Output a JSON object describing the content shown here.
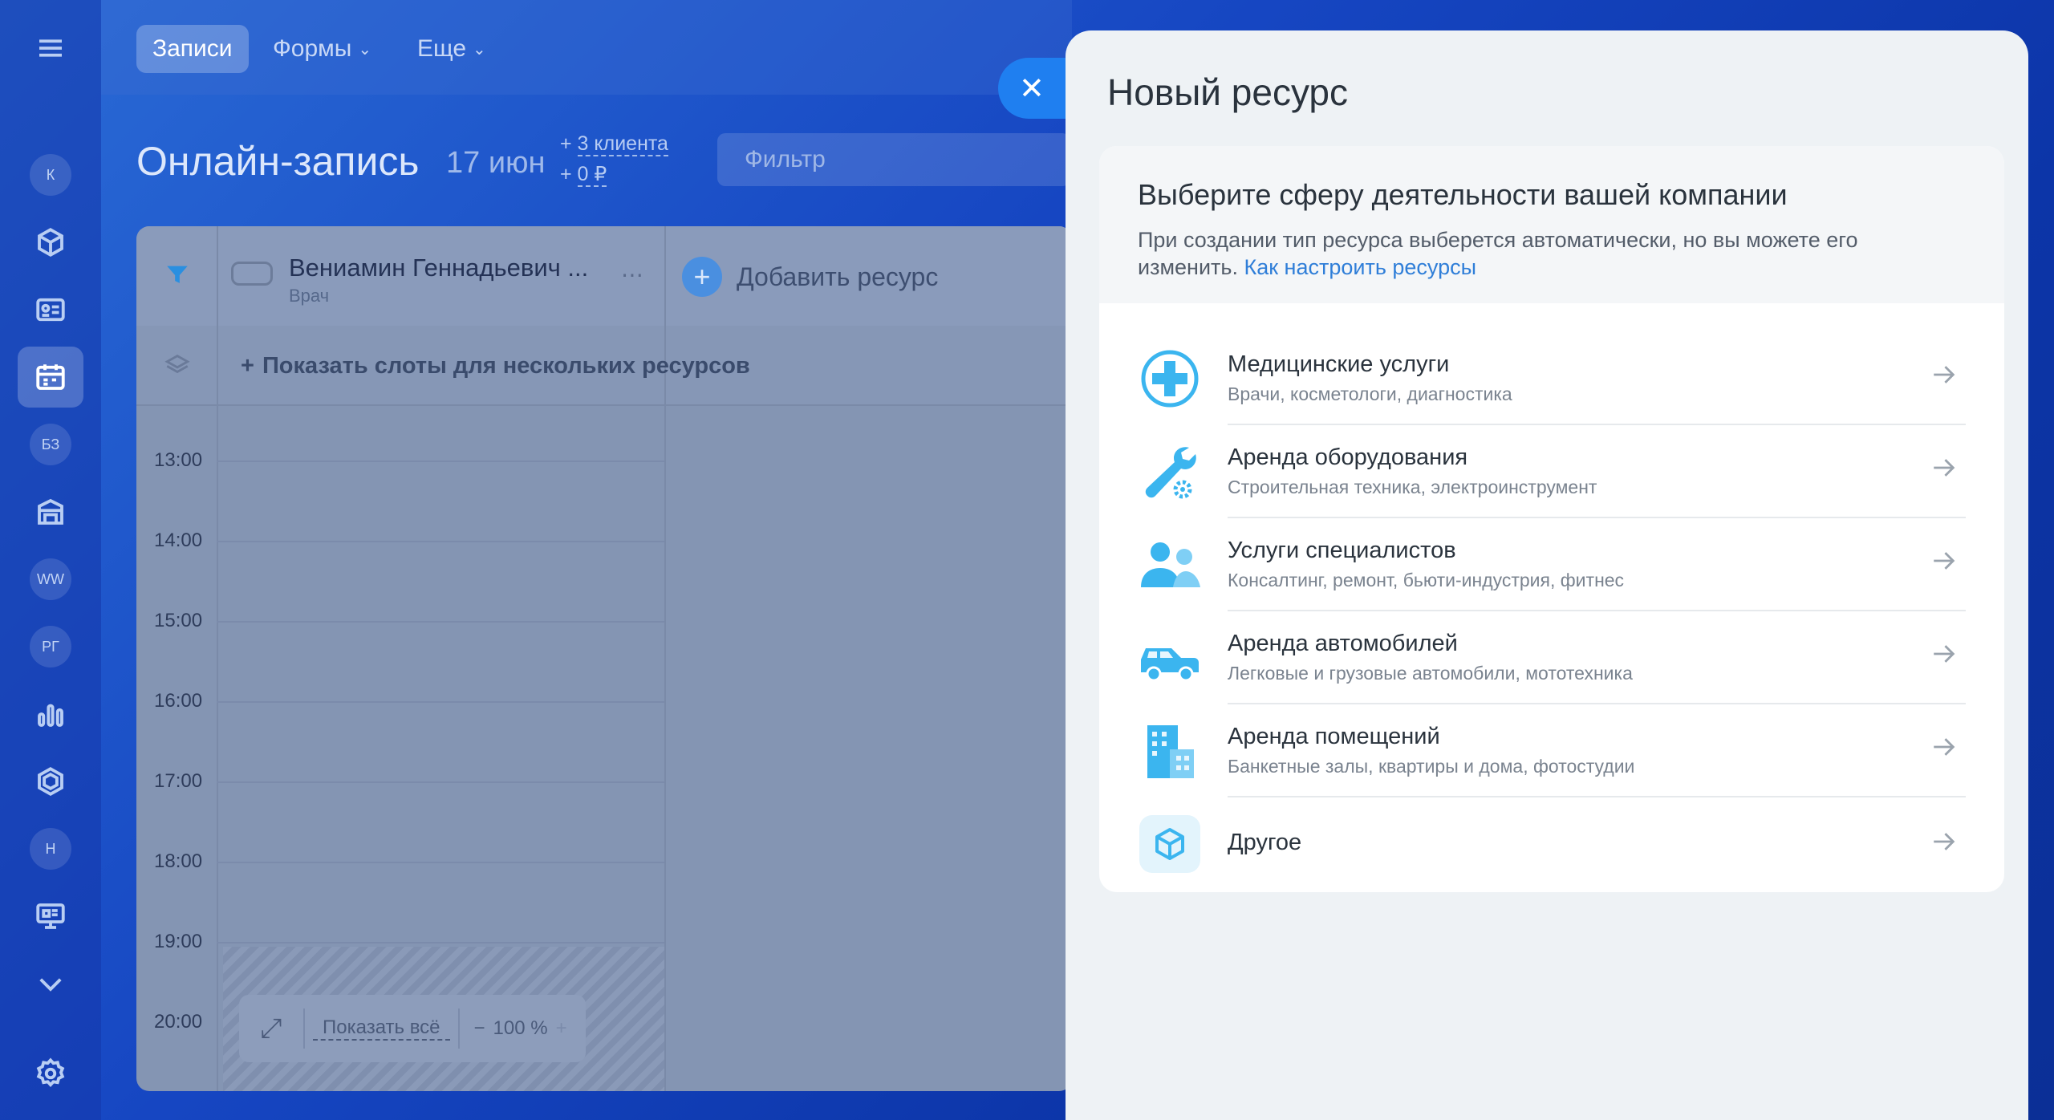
{
  "sidebar": {
    "circles": [
      "К",
      "БЗ",
      "WW",
      "РГ",
      "Н"
    ]
  },
  "topbar": {
    "tabs": [
      "Записи",
      "Формы",
      "Еще"
    ]
  },
  "page": {
    "title": "Онлайн-запись",
    "date": "17 июн",
    "clients": "3 клиента",
    "money": "0 ₽",
    "filter_placeholder": "Фильтр"
  },
  "calendar": {
    "resource_name": "Вениамин Геннадьевич ...",
    "resource_role": "Врач",
    "add_resource": "Добавить ресурс",
    "show_slots": "Показать слоты для нескольких ресурсов",
    "hours": [
      "13:00",
      "14:00",
      "15:00",
      "16:00",
      "17:00",
      "18:00",
      "19:00",
      "20:00"
    ],
    "show_all": "Показать всё",
    "zoom": "100 %"
  },
  "panel": {
    "title": "Новый ресурс",
    "heading": "Выберите сферу деятельности вашей компании",
    "desc": "При создании тип ресурса выберется автоматически, но вы можете его изменить.",
    "desc_link": "Как настроить ресурсы",
    "items": [
      {
        "title": "Медицинские услуги",
        "sub": "Врачи, косметологи, диагностика",
        "icon": "medical-cross-icon"
      },
      {
        "title": "Аренда оборудования",
        "sub": "Строительная техника, электроинструмент",
        "icon": "wrench-gear-icon"
      },
      {
        "title": "Услуги специалистов",
        "sub": "Консалтинг, ремонт, бьюти-индустрия, фитнес",
        "icon": "people-icon"
      },
      {
        "title": "Аренда автомобилей",
        "sub": "Легковые и грузовые автомобили, мототехника",
        "icon": "car-icon"
      },
      {
        "title": "Аренда помещений",
        "sub": "Банкетные залы, квартиры и дома, фотостудии",
        "icon": "building-icon"
      },
      {
        "title": "Другое",
        "sub": "",
        "icon": "box-icon"
      }
    ]
  },
  "colors": {
    "accent": "#2f7ed8",
    "icon_blue": "#3bb5ef",
    "close_btn": "#1f7ff0"
  }
}
